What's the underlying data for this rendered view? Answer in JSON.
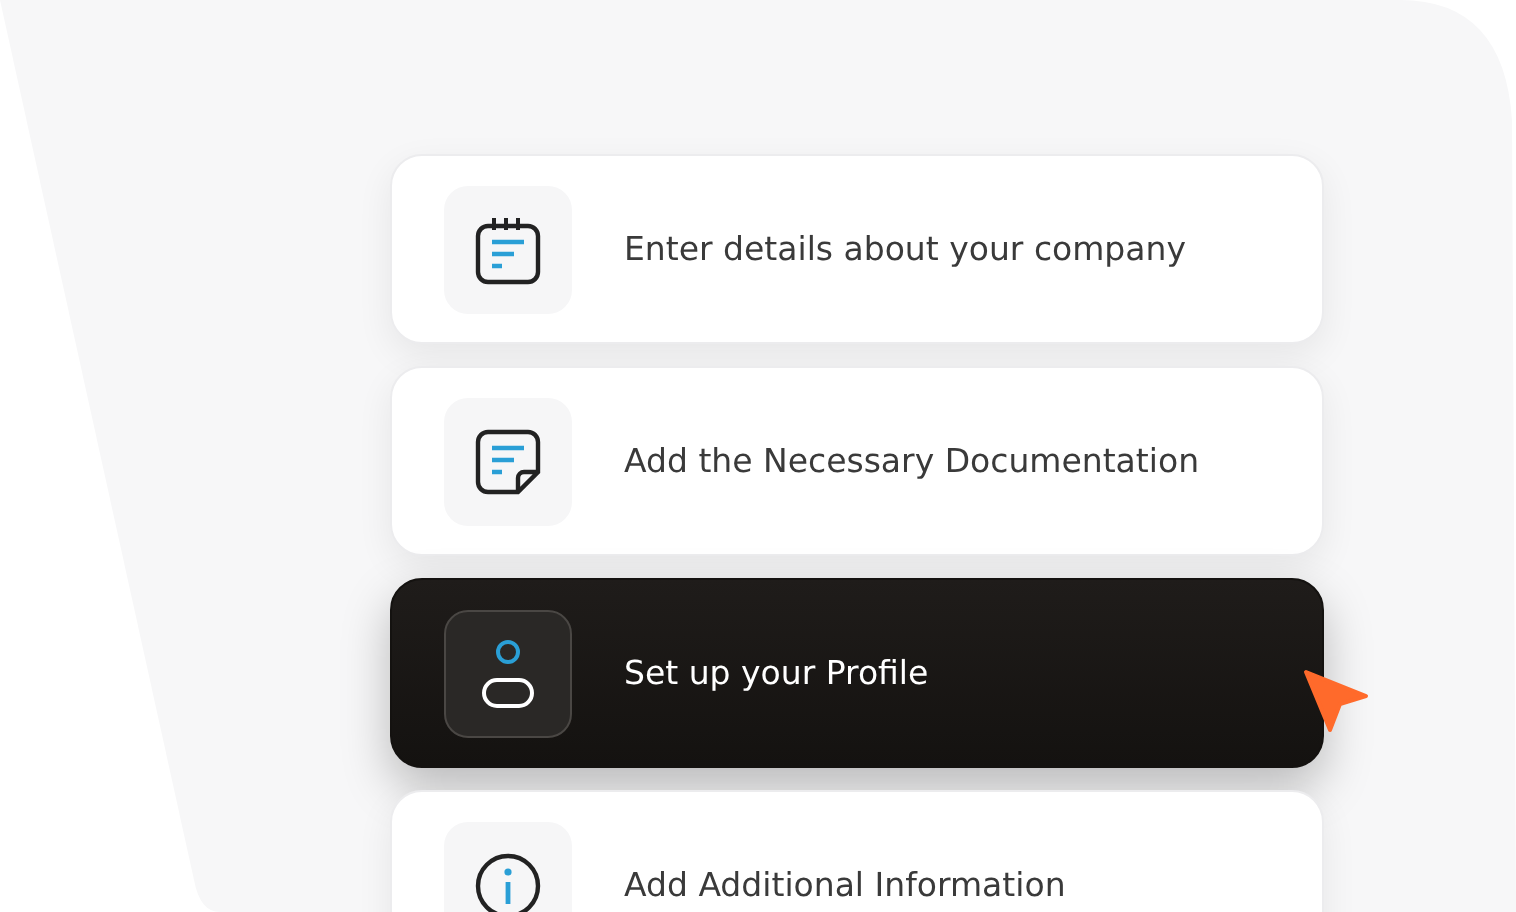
{
  "steps": [
    {
      "label": "Enter details about your company",
      "kind": "calendar",
      "selected": false
    },
    {
      "label": "Add the Necessary Documentation",
      "kind": "document",
      "selected": false
    },
    {
      "label": "Set up your Profile",
      "kind": "profile",
      "selected": true
    },
    {
      "label": "Add Additional Information",
      "kind": "info",
      "selected": false
    }
  ]
}
